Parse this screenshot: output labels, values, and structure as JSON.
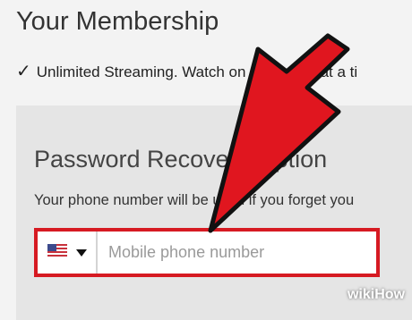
{
  "membership": {
    "title": "Your Membership",
    "check_mark": "✓",
    "feature": "Unlimited Streaming. Watch on 4 screens at a ti"
  },
  "recovery": {
    "title": "Password Recovery Option",
    "description": "Your phone number will be used if you forget you"
  },
  "phone": {
    "country_icon": "us-flag-icon",
    "dropdown_icon": "caret-down-icon",
    "placeholder": "Mobile phone number",
    "value": ""
  },
  "colors": {
    "highlight_border": "#d61a22",
    "arrow_fill": "#e0161f",
    "arrow_outline": "#111111"
  },
  "watermark": {
    "wiki": "wiki",
    "how": "How"
  }
}
